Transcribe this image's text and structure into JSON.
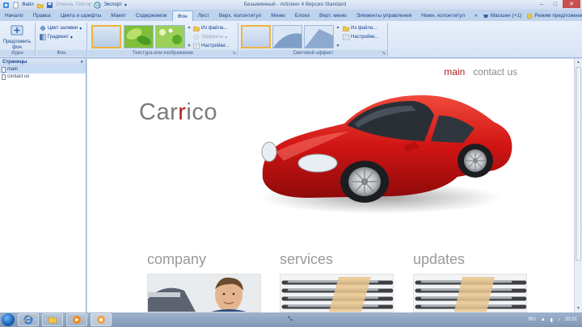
{
  "titlebar": {
    "file_menu": "Файл",
    "undo": "Отмена",
    "redo": "Повтор",
    "export": "Экспорт",
    "window_title": "Безымянный - Artisteer 4 Версия Standard"
  },
  "tabs": [
    {
      "label": "Начало"
    },
    {
      "label": "Правка"
    },
    {
      "label": "Цвета и шрифты"
    },
    {
      "label": "Макет"
    },
    {
      "label": "Содержимое"
    },
    {
      "label": "Фон"
    },
    {
      "label": "Лист"
    },
    {
      "label": "Верх. колонтитул"
    },
    {
      "label": "Меню"
    },
    {
      "label": "Блоки"
    },
    {
      "label": "Верт. меню"
    },
    {
      "label": "Элементы управления"
    },
    {
      "label": "Нижн. колонтитул"
    }
  ],
  "active_tab": "Фон",
  "tabs_right": {
    "more": "«",
    "shop": "Магазин (+1)",
    "suggestions": "Режим предложений"
  },
  "ribbon": {
    "ideas_group": {
      "button": "Предложить фон",
      "label": "Идеи"
    },
    "bg_group": {
      "fill_color": "Цвет заливки",
      "gradient": "Градиент",
      "label": "Фон"
    },
    "texture_group": {
      "from_file": "Из файла...",
      "effects": "Эффекты",
      "settings": "Настройки...",
      "label": "Текстура или изображение"
    },
    "glow_group": {
      "from_file": "Из файла...",
      "settings": "Настройки...",
      "label": "Световой эффект"
    }
  },
  "pages_panel": {
    "header": "Страницы",
    "collapse": "«",
    "items": [
      {
        "label": "main"
      },
      {
        "label": "contact us"
      }
    ]
  },
  "site": {
    "nav": {
      "main": "main",
      "contact": "contact us"
    },
    "logo_start": "Car",
    "logo_r": "r",
    "logo_end": "ico",
    "sections": [
      {
        "title": "company"
      },
      {
        "title": "services"
      },
      {
        "title": "updates"
      }
    ]
  },
  "taskbar": {
    "lang": "RU",
    "time": "20:31"
  },
  "colors": {
    "accent_red": "#b22222",
    "ribbon_blue": "#15428b",
    "car_red": "#d01414"
  }
}
